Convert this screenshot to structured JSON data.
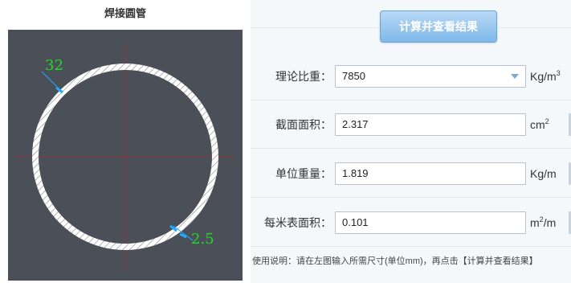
{
  "left_panel": {
    "title": "焊接圆管",
    "diagram": {
      "outer_diameter_label": "32",
      "thickness_label": "2.5",
      "background": "#4b4f57",
      "dimension_color": "#22dd22",
      "leader_color": "#22aaff",
      "centerline_color": "#cc2222"
    }
  },
  "right_panel": {
    "calc_button_label": "计算并查看结果",
    "fields": [
      {
        "label": "理论比重：",
        "value": "7850",
        "unit_base": "Kg/m",
        "unit_sup": "3",
        "type": "select"
      },
      {
        "label": "截面面积：",
        "value": "2.317",
        "unit_base": "cm",
        "unit_sup": "2",
        "type": "input"
      },
      {
        "label": "单位重量：",
        "value": "1.819",
        "unit_base": "Kg/m",
        "unit_sup": "",
        "type": "input"
      },
      {
        "label": "每米表面积：",
        "value": "0.101",
        "unit_base": "m",
        "unit_sup": "2",
        "unit_suffix": "/m",
        "type": "input"
      }
    ],
    "usage_note": "使用说明：请在左图输入所需尺寸(单位mm)，再点击【计算并查看结果】"
  }
}
